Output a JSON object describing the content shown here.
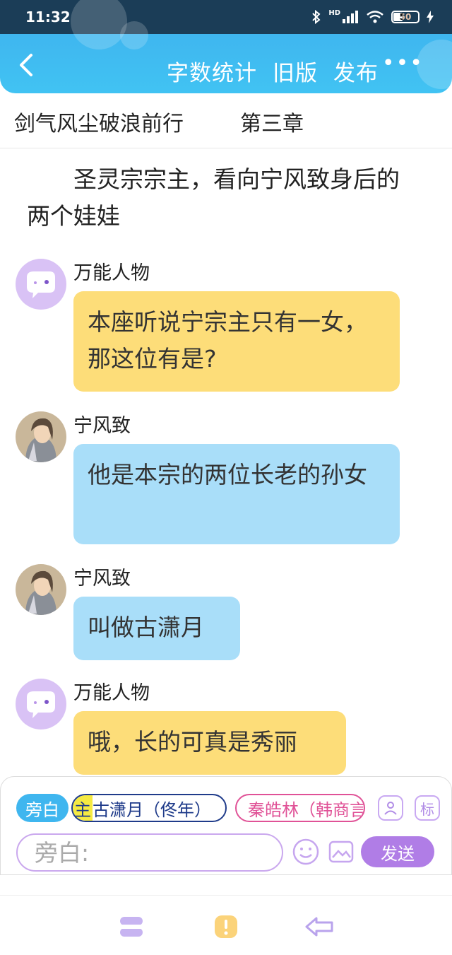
{
  "status_bar": {
    "time": "11:32",
    "network": "HD",
    "battery": "50"
  },
  "header": {
    "back": "<",
    "actions": [
      "字数统计",
      "旧版",
      "发布"
    ],
    "more": "•••"
  },
  "chapter": {
    "book_title": "剑气风尘破浪前行",
    "chapter_title": "第三章"
  },
  "narration": "圣灵宗宗主，看向宁风致身后的两个娃娃",
  "messages": [
    {
      "speaker": "万能人物",
      "text": "本座听说宁宗主只有一女，那这位有是?",
      "style": "yellow",
      "avatar": "chat-bubble-avatar"
    },
    {
      "speaker": "宁风致",
      "text": "他是本宗的两位长老的孙女",
      "style": "blue",
      "avatar": "character-portrait"
    },
    {
      "speaker": "宁风致",
      "text": "叫做古潇月",
      "style": "blue",
      "avatar": "character-portrait"
    },
    {
      "speaker": "万能人物",
      "text": "哦，长的可真是秀丽",
      "style": "yellow",
      "avatar": "chat-bubble-avatar"
    }
  ],
  "input_panel": {
    "roles": {
      "narrator": "旁白",
      "main_tag": "主",
      "main_role": "古潇月（佟年）",
      "second_role": "秦皓林（韩商言"
    },
    "mark_button": "标",
    "input_placeholder": "旁白:",
    "send_label": "发送"
  },
  "colors": {
    "header_gradient": "#41c3f3",
    "bubble_yellow": "#fddd79",
    "bubble_blue": "#a9def9",
    "send_button": "#b07de6"
  }
}
